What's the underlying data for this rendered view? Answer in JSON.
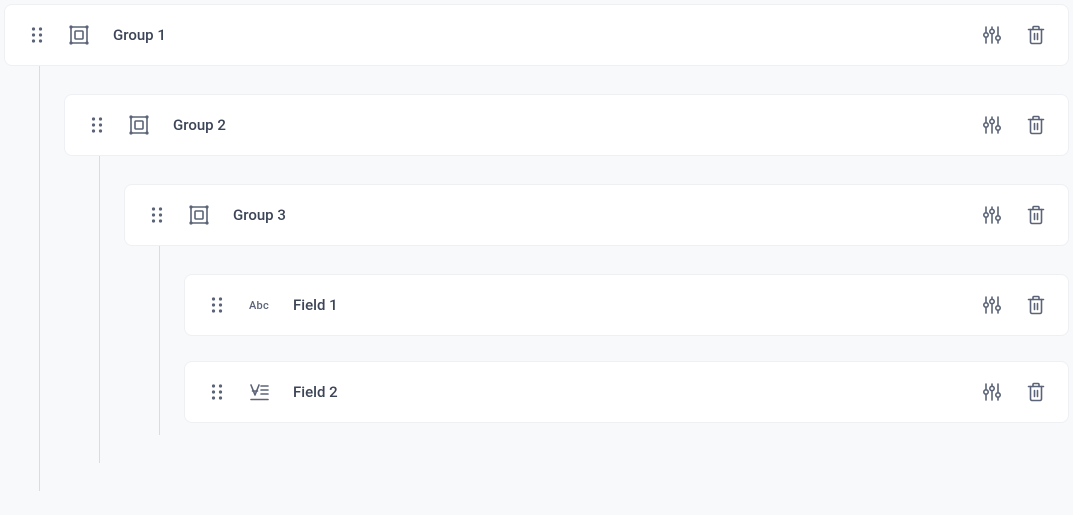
{
  "tree": {
    "group1": {
      "label": "Group 1"
    },
    "group2": {
      "label": "Group 2"
    },
    "group3": {
      "label": "Group 3"
    },
    "field1": {
      "label": "Field 1",
      "type_label": "Abc"
    },
    "field2": {
      "label": "Field 2"
    }
  }
}
